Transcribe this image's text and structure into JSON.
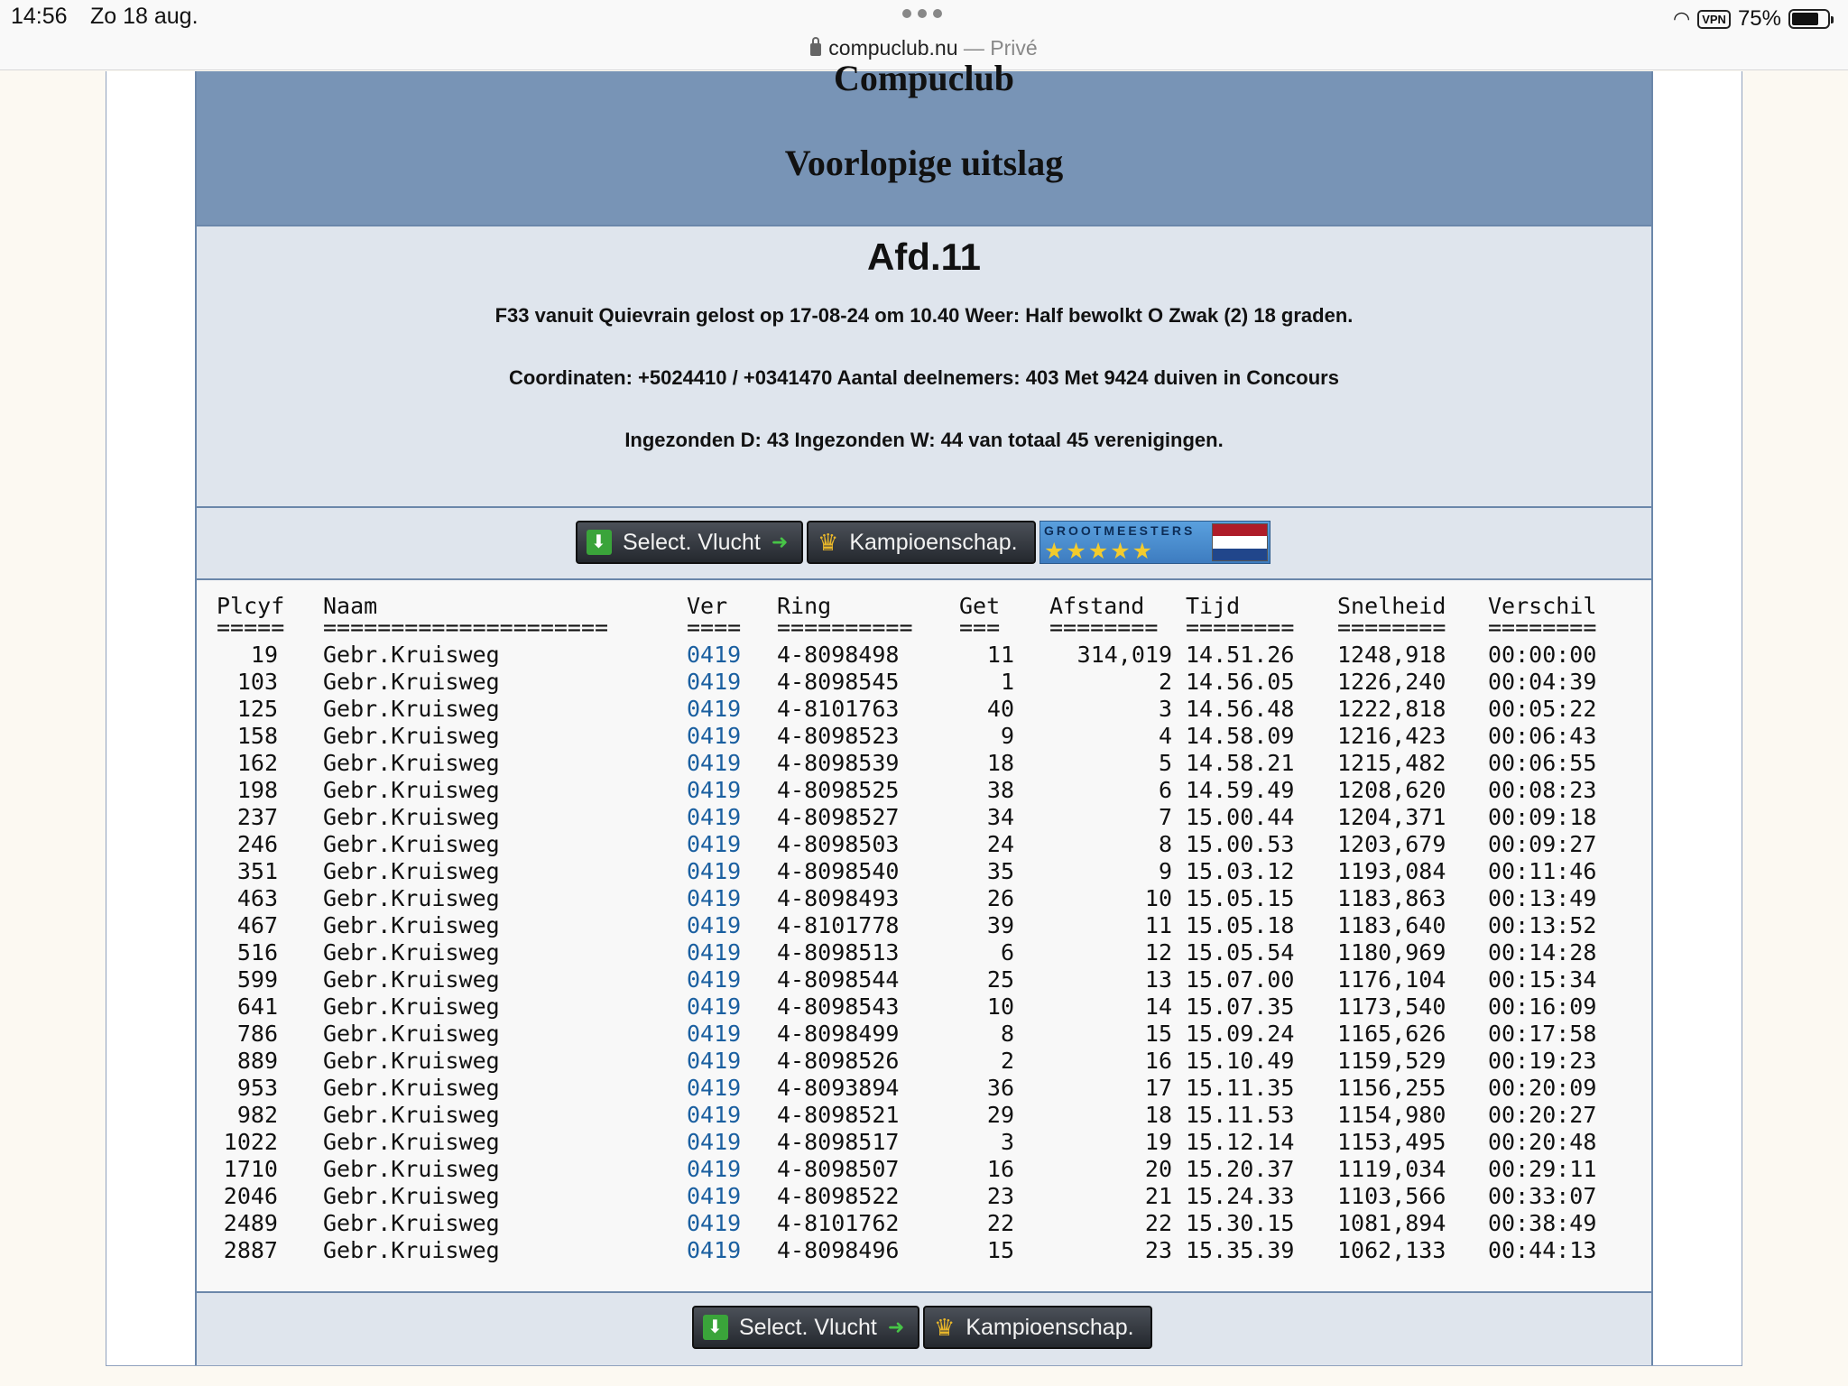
{
  "status_bar": {
    "time": "14:56",
    "date": "Zo 18 aug.",
    "vpn": "VPN",
    "battery": "75%"
  },
  "browser": {
    "url": "compuclub.nu",
    "mode": "— Privé"
  },
  "banner": {
    "club": "Compuclub",
    "subtitle": "Voorlopige uitslag"
  },
  "info": {
    "afdeling": "Afd.11",
    "line1": "F33 vanuit Quievrain gelost op 17-08-24 om 10.40 Weer: Half bewolkt O Zwak (2) 18 graden.",
    "line2": "Coordinaten: +5024410 / +0341470 Aantal deelnemers: 403 Met 9424 duiven in Concours",
    "line3": "Ingezonden D: 43 Ingezonden W: 44 van totaal 45 verenigingen."
  },
  "buttons": {
    "select_vlucht": "Select. Vlucht",
    "kampioenschap": "Kampioenschap.",
    "grootmeesters": "GROOTMEESTERS",
    "stars": "★★★★★"
  },
  "table": {
    "headers": {
      "plcyf": "Plcyf",
      "naam": "Naam",
      "ver": "Ver",
      "ring": "Ring",
      "get": "Get",
      "afstand": "Afstand",
      "tijd": "Tijd",
      "snelheid": "Snelheid",
      "verschil": "Verschil"
    },
    "underlines": {
      "plcyf": "=====",
      "naam": "=====================",
      "ver": "====",
      "ring": "==========",
      "get": "===",
      "afstand": "========",
      "tijd": "========",
      "snelheid": "========",
      "verschil": "========"
    },
    "rows": [
      {
        "plcyf": "19",
        "naam": "Gebr.Kruisweg",
        "ver": "0419",
        "ring": "4-8098498",
        "get": "11",
        "afstand": "314,019",
        "tijd": "14.51.26",
        "snelheid": "1248,918",
        "verschil": "00:00:00"
      },
      {
        "plcyf": "103",
        "naam": "Gebr.Kruisweg",
        "ver": "0419",
        "ring": "4-8098545",
        "get": "1",
        "afstand": "2",
        "tijd": "14.56.05",
        "snelheid": "1226,240",
        "verschil": "00:04:39"
      },
      {
        "plcyf": "125",
        "naam": "Gebr.Kruisweg",
        "ver": "0419",
        "ring": "4-8101763",
        "get": "40",
        "afstand": "3",
        "tijd": "14.56.48",
        "snelheid": "1222,818",
        "verschil": "00:05:22"
      },
      {
        "plcyf": "158",
        "naam": "Gebr.Kruisweg",
        "ver": "0419",
        "ring": "4-8098523",
        "get": "9",
        "afstand": "4",
        "tijd": "14.58.09",
        "snelheid": "1216,423",
        "verschil": "00:06:43"
      },
      {
        "plcyf": "162",
        "naam": "Gebr.Kruisweg",
        "ver": "0419",
        "ring": "4-8098539",
        "get": "18",
        "afstand": "5",
        "tijd": "14.58.21",
        "snelheid": "1215,482",
        "verschil": "00:06:55"
      },
      {
        "plcyf": "198",
        "naam": "Gebr.Kruisweg",
        "ver": "0419",
        "ring": "4-8098525",
        "get": "38",
        "afstand": "6",
        "tijd": "14.59.49",
        "snelheid": "1208,620",
        "verschil": "00:08:23"
      },
      {
        "plcyf": "237",
        "naam": "Gebr.Kruisweg",
        "ver": "0419",
        "ring": "4-8098527",
        "get": "34",
        "afstand": "7",
        "tijd": "15.00.44",
        "snelheid": "1204,371",
        "verschil": "00:09:18"
      },
      {
        "plcyf": "246",
        "naam": "Gebr.Kruisweg",
        "ver": "0419",
        "ring": "4-8098503",
        "get": "24",
        "afstand": "8",
        "tijd": "15.00.53",
        "snelheid": "1203,679",
        "verschil": "00:09:27"
      },
      {
        "plcyf": "351",
        "naam": "Gebr.Kruisweg",
        "ver": "0419",
        "ring": "4-8098540",
        "get": "35",
        "afstand": "9",
        "tijd": "15.03.12",
        "snelheid": "1193,084",
        "verschil": "00:11:46"
      },
      {
        "plcyf": "463",
        "naam": "Gebr.Kruisweg",
        "ver": "0419",
        "ring": "4-8098493",
        "get": "26",
        "afstand": "10",
        "tijd": "15.05.15",
        "snelheid": "1183,863",
        "verschil": "00:13:49"
      },
      {
        "plcyf": "467",
        "naam": "Gebr.Kruisweg",
        "ver": "0419",
        "ring": "4-8101778",
        "get": "39",
        "afstand": "11",
        "tijd": "15.05.18",
        "snelheid": "1183,640",
        "verschil": "00:13:52"
      },
      {
        "plcyf": "516",
        "naam": "Gebr.Kruisweg",
        "ver": "0419",
        "ring": "4-8098513",
        "get": "6",
        "afstand": "12",
        "tijd": "15.05.54",
        "snelheid": "1180,969",
        "verschil": "00:14:28"
      },
      {
        "plcyf": "599",
        "naam": "Gebr.Kruisweg",
        "ver": "0419",
        "ring": "4-8098544",
        "get": "25",
        "afstand": "13",
        "tijd": "15.07.00",
        "snelheid": "1176,104",
        "verschil": "00:15:34"
      },
      {
        "plcyf": "641",
        "naam": "Gebr.Kruisweg",
        "ver": "0419",
        "ring": "4-8098543",
        "get": "10",
        "afstand": "14",
        "tijd": "15.07.35",
        "snelheid": "1173,540",
        "verschil": "00:16:09"
      },
      {
        "plcyf": "786",
        "naam": "Gebr.Kruisweg",
        "ver": "0419",
        "ring": "4-8098499",
        "get": "8",
        "afstand": "15",
        "tijd": "15.09.24",
        "snelheid": "1165,626",
        "verschil": "00:17:58"
      },
      {
        "plcyf": "889",
        "naam": "Gebr.Kruisweg",
        "ver": "0419",
        "ring": "4-8098526",
        "get": "2",
        "afstand": "16",
        "tijd": "15.10.49",
        "snelheid": "1159,529",
        "verschil": "00:19:23"
      },
      {
        "plcyf": "953",
        "naam": "Gebr.Kruisweg",
        "ver": "0419",
        "ring": "4-8093894",
        "get": "36",
        "afstand": "17",
        "tijd": "15.11.35",
        "snelheid": "1156,255",
        "verschil": "00:20:09"
      },
      {
        "plcyf": "982",
        "naam": "Gebr.Kruisweg",
        "ver": "0419",
        "ring": "4-8098521",
        "get": "29",
        "afstand": "18",
        "tijd": "15.11.53",
        "snelheid": "1154,980",
        "verschil": "00:20:27"
      },
      {
        "plcyf": "1022",
        "naam": "Gebr.Kruisweg",
        "ver": "0419",
        "ring": "4-8098517",
        "get": "3",
        "afstand": "19",
        "tijd": "15.12.14",
        "snelheid": "1153,495",
        "verschil": "00:20:48"
      },
      {
        "plcyf": "1710",
        "naam": "Gebr.Kruisweg",
        "ver": "0419",
        "ring": "4-8098507",
        "get": "16",
        "afstand": "20",
        "tijd": "15.20.37",
        "snelheid": "1119,034",
        "verschil": "00:29:11"
      },
      {
        "plcyf": "2046",
        "naam": "Gebr.Kruisweg",
        "ver": "0419",
        "ring": "4-8098522",
        "get": "23",
        "afstand": "21",
        "tijd": "15.24.33",
        "snelheid": "1103,566",
        "verschil": "00:33:07"
      },
      {
        "plcyf": "2489",
        "naam": "Gebr.Kruisweg",
        "ver": "0419",
        "ring": "4-8101762",
        "get": "22",
        "afstand": "22",
        "tijd": "15.30.15",
        "snelheid": "1081,894",
        "verschil": "00:38:49"
      },
      {
        "plcyf": "2887",
        "naam": "Gebr.Kruisweg",
        "ver": "0419",
        "ring": "4-8098496",
        "get": "15",
        "afstand": "23",
        "tijd": "15.35.39",
        "snelheid": "1062,133",
        "verschil": "00:44:13"
      }
    ]
  }
}
